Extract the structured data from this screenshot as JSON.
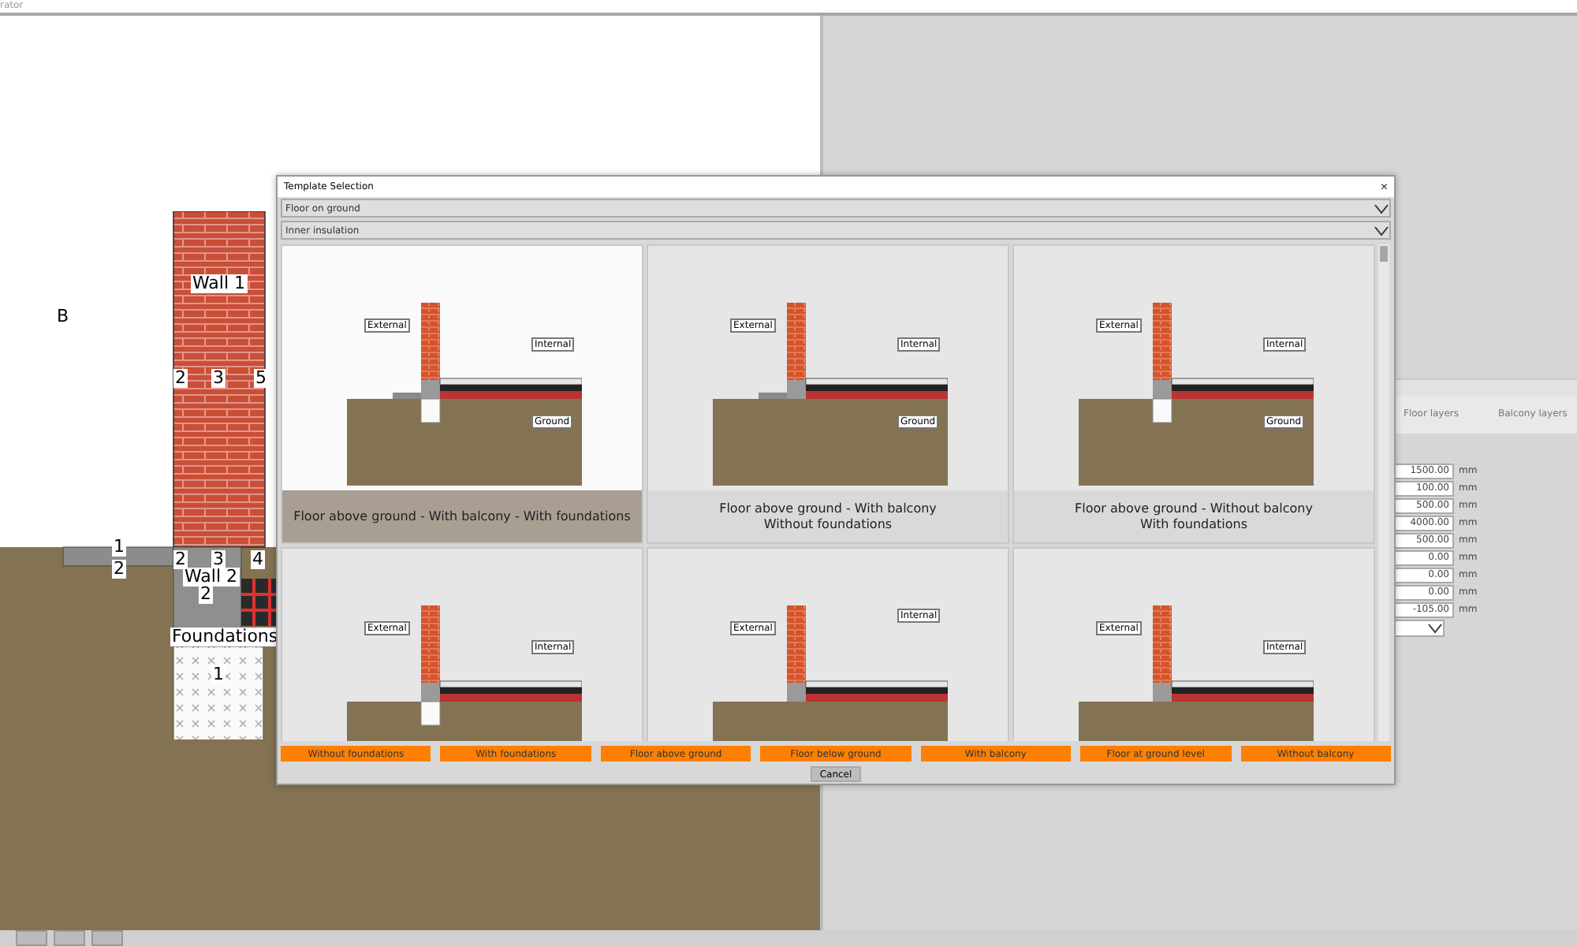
{
  "window": {
    "title": "rator"
  },
  "canvas": {
    "labels": [
      "B",
      "Wall 1",
      "2",
      "3",
      "5",
      "1",
      "2",
      "2",
      "3",
      "4",
      "Wall 2",
      "2",
      "Foundations",
      "1"
    ]
  },
  "properties": {
    "columns": [
      "Floor layers",
      "Balcony layers"
    ],
    "fields": [
      {
        "value": "1500.00",
        "unit": "mm"
      },
      {
        "value": "100.00",
        "unit": "mm"
      },
      {
        "value": "500.00",
        "unit": "mm"
      },
      {
        "value": "4000.00",
        "unit": "mm"
      },
      {
        "value": "500.00",
        "unit": "mm"
      },
      {
        "value": "0.00",
        "unit": "mm"
      },
      {
        "value": "0.00",
        "unit": "mm"
      },
      {
        "value": "0.00",
        "unit": "mm"
      },
      {
        "value": "-105.00",
        "unit": "mm"
      }
    ]
  },
  "dialog": {
    "title": "Template Selection",
    "close": "×",
    "selects": [
      {
        "value": "Floor on ground"
      },
      {
        "value": "Inner insulation"
      }
    ],
    "templates": [
      {
        "selected": true,
        "balcony": true,
        "foundations": true,
        "labels": [
          "External",
          "Internal",
          "Ground"
        ],
        "caption": "Floor above ground - With balcony - With foundations"
      },
      {
        "selected": false,
        "balcony": true,
        "foundations": false,
        "labels": [
          "External",
          "Internal",
          "Ground"
        ],
        "caption": "Floor above ground - With balcony\nWithout foundations"
      },
      {
        "selected": false,
        "balcony": false,
        "foundations": true,
        "labels": [
          "External",
          "Internal",
          "Ground"
        ],
        "caption": "Floor above ground - Without balcony\nWith foundations"
      },
      {
        "selected": false,
        "balcony": false,
        "foundations": true,
        "labels": [
          "External",
          "Internal"
        ]
      },
      {
        "selected": false,
        "balcony": false,
        "foundations": false,
        "labels": [
          "External",
          "Internal"
        ]
      },
      {
        "selected": false,
        "balcony": false,
        "foundations": false,
        "labels": [
          "External",
          "Internal"
        ]
      }
    ],
    "filters": [
      "Without foundations",
      "With foundations",
      "Floor above ground",
      "Floor below ground",
      "With balcony",
      "Floor at ground level",
      "Without balcony"
    ],
    "cancel": "Cancel"
  }
}
